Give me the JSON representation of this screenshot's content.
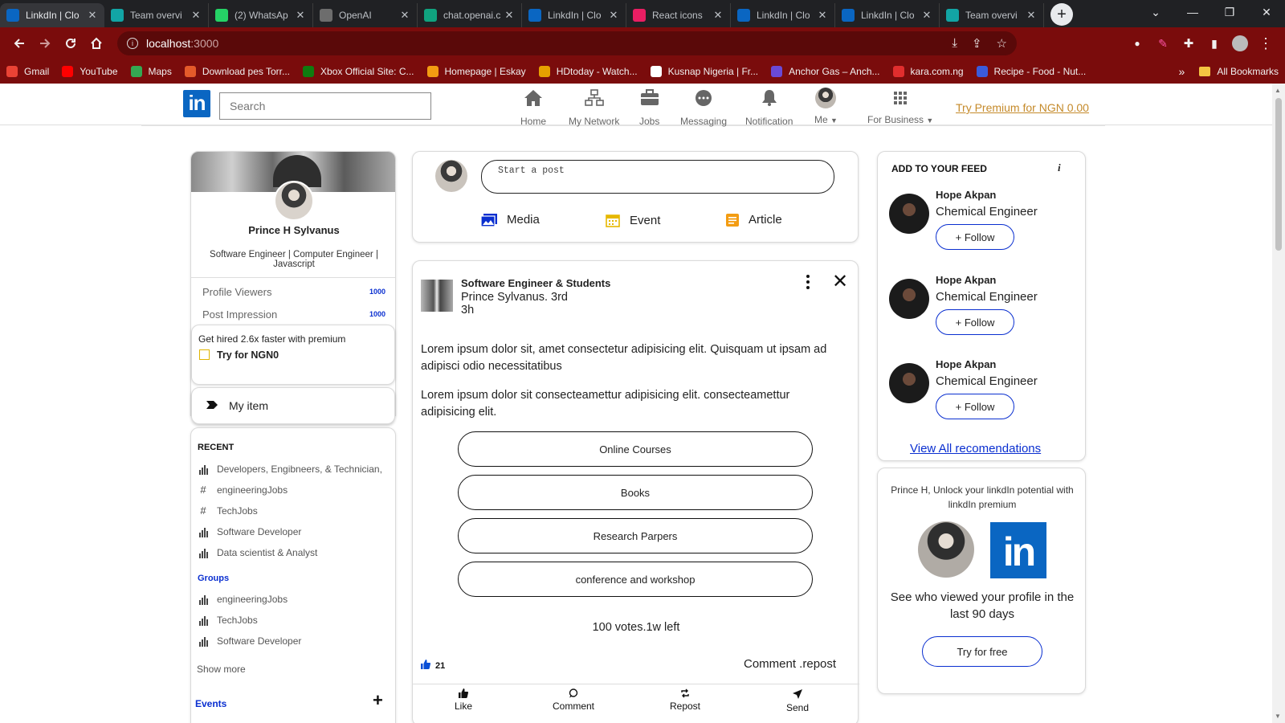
{
  "browser": {
    "tabs": [
      {
        "title": "LinkdIn | Clo",
        "icon": "linkedin-icon",
        "color": "#0a66c2",
        "active": true
      },
      {
        "title": "Team overvi",
        "icon": "globe-icon",
        "color": "#12a5a5",
        "active": false
      },
      {
        "title": "(2) WhatsAp",
        "icon": "whatsapp-icon",
        "color": "#25d366",
        "active": false
      },
      {
        "title": "OpenAI",
        "icon": "globe-icon",
        "color": "#6d6d6d",
        "active": false
      },
      {
        "title": "chat.openai.c",
        "icon": "openai-icon",
        "color": "#10a37f",
        "active": false
      },
      {
        "title": "LinkdIn | Clo",
        "icon": "linkedin-icon",
        "color": "#0a66c2",
        "active": false
      },
      {
        "title": "React icons",
        "icon": "react-icons-icon",
        "color": "#e91e63",
        "active": false
      },
      {
        "title": "LinkdIn | Clo",
        "icon": "linkedin-icon",
        "color": "#0a66c2",
        "active": false
      },
      {
        "title": "LinkdIn | Clo",
        "icon": "linkedin-icon",
        "color": "#0a66c2",
        "active": false
      },
      {
        "title": "Team overvi",
        "icon": "globe-icon",
        "color": "#12a5a5",
        "active": false
      }
    ],
    "url_host": "localhost",
    "url_port": ":3000",
    "bookmarks": [
      {
        "label": "Gmail",
        "color": "#ea4335"
      },
      {
        "label": "YouTube",
        "color": "#ff0000"
      },
      {
        "label": "Maps",
        "color": "#34a853"
      },
      {
        "label": "Download pes Torr...",
        "color": "#e45a2a"
      },
      {
        "label": "Xbox Official Site: C...",
        "color": "#107c10"
      },
      {
        "label": "Homepage | Eskay",
        "color": "#f39c12"
      },
      {
        "label": "HDtoday - Watch...",
        "color": "#e6a100"
      },
      {
        "label": "Kusnap Nigeria | Fr...",
        "color": "#ffffff"
      },
      {
        "label": "Anchor Gas – Anch...",
        "color": "#6a4ad6"
      },
      {
        "label": "kara.com.ng",
        "color": "#e12e2e"
      },
      {
        "label": "Recipe - Food - Nut...",
        "color": "#3b5bdb"
      }
    ],
    "bookmarks_more": "»",
    "all_bookmarks": "All Bookmarks"
  },
  "nav": {
    "logo": "in",
    "search_placeholder": "Search",
    "items": [
      {
        "label": "Home",
        "icon": "home-icon"
      },
      {
        "label": "My Network",
        "icon": "network-icon"
      },
      {
        "label": "Jobs",
        "icon": "briefcase-icon"
      },
      {
        "label": "Messaging",
        "icon": "message-icon"
      },
      {
        "label": "Notification",
        "icon": "bell-icon"
      },
      {
        "label": "Me",
        "icon": "avatar-icon"
      },
      {
        "label": "For Business",
        "icon": "grid-icon"
      }
    ],
    "premium": "Try Premium for NGN 0.00"
  },
  "profile": {
    "name": "Prince H Sylvanus",
    "headline": "Software Engineer | Computer Engineer | Javascript",
    "stats": [
      {
        "label": "Profile Viewers",
        "value": "1000"
      },
      {
        "label": "Post Impression",
        "value": "1000"
      }
    ],
    "premium_text": "Get hired 2.6x faster with premium",
    "premium_cta": "Try for NGN0",
    "my_item": "My item"
  },
  "recent": {
    "heading": "RECENT",
    "items": [
      {
        "label": "Developers, Engibneers, & Technician,",
        "icon": "bar-chart-icon"
      },
      {
        "label": "engineeringJobs",
        "icon": "hashtag-icon"
      },
      {
        "label": "TechJobs",
        "icon": "hashtag-icon"
      },
      {
        "label": "Software Developer",
        "icon": "bar-chart-icon"
      },
      {
        "label": "Data scientist & Analyst",
        "icon": "bar-chart-icon"
      }
    ],
    "groups_heading": "Groups",
    "groups": [
      {
        "label": "engineeringJobs",
        "icon": "bar-chart-icon"
      },
      {
        "label": "TechJobs",
        "icon": "bar-chart-icon"
      },
      {
        "label": "Software Developer",
        "icon": "bar-chart-icon"
      }
    ],
    "show_more": "Show more",
    "events_heading": "Events",
    "events_add": "+"
  },
  "composer": {
    "placeholder": "Start a post",
    "actions": [
      {
        "label": "Media",
        "icon": "image-icon",
        "color": "#0a2fd0"
      },
      {
        "label": "Event",
        "icon": "calendar-icon",
        "color": "#e6b800"
      },
      {
        "label": "Article",
        "icon": "article-icon",
        "color": "#f39c12"
      }
    ]
  },
  "post": {
    "title": "Software Engineer & Students",
    "author": "Prince Sylvanus. 3rd",
    "time": "3h",
    "paragraphs": [
      "Lorem ipsum dolor sit, amet consectetur adipisicing elit. Quisquam ut ipsam ad adipisci odio necessitatibus",
      "Lorem ipsum dolor sit consecteamettur adipisicing elit. consecteamettur adipisicing elit."
    ],
    "poll_options": [
      "Online Courses",
      "Books",
      "Research Parpers",
      "conference and workshop"
    ],
    "votes": "100 votes.1w left",
    "likes": "21",
    "comment_repost": "Comment .repost",
    "actions": [
      "Like",
      "Comment",
      "Repost",
      "Send"
    ]
  },
  "feed": {
    "heading": "ADD TO YOUR FEED",
    "info": "i",
    "recommendations": [
      {
        "name": "Hope Akpan",
        "title": "Chemical Engineer",
        "follow": "+ Follow"
      },
      {
        "name": "Hope Akpan",
        "title": "Chemical Engineer",
        "follow": "+ Follow"
      },
      {
        "name": "Hope Akpan",
        "title": "Chemical Engineer",
        "follow": "+ Follow"
      }
    ],
    "view_all": "View All recomendations"
  },
  "promo": {
    "text": "Prince H, Unlock your linkdIn potential with linkdIn premium",
    "logo": "in",
    "desc": "See who viewed your profile in the last 90 days",
    "button": "Try for free"
  }
}
